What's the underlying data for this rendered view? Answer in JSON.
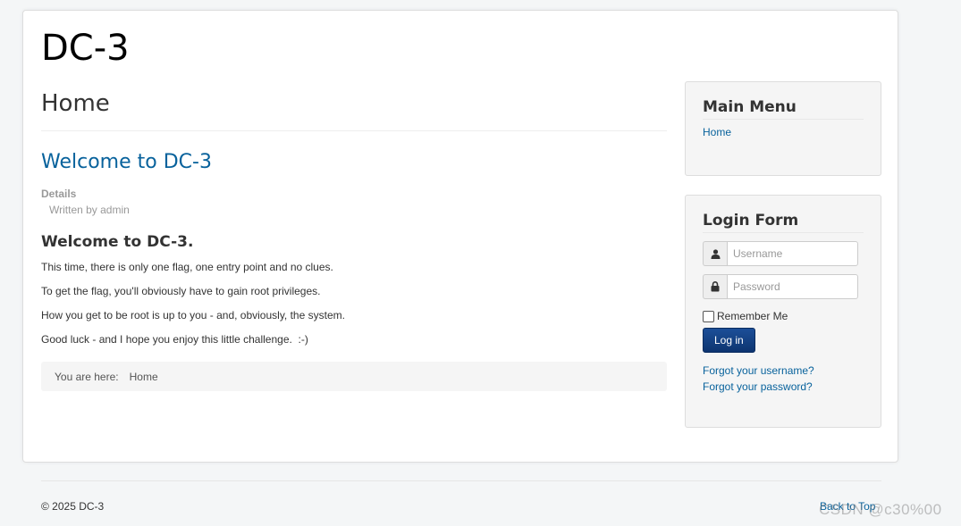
{
  "site": {
    "title": "DC-3"
  },
  "main": {
    "page_heading": "Home",
    "article": {
      "title": "Welcome to DC-3",
      "details_label": "Details",
      "author_line": "Written by admin",
      "heading": "Welcome to DC-3.",
      "paragraphs": [
        "This time, there is only one flag, one entry point and no clues.",
        "To get the flag, you'll obviously have to gain root privileges.",
        "How you get to be root is up to you - and, obviously, the system.",
        "Good luck - and I hope you enjoy this little challenge.  :-)"
      ]
    },
    "breadcrumb": {
      "label": "You are here:",
      "current": "Home"
    }
  },
  "sidebar": {
    "main_menu": {
      "title": "Main Menu",
      "items": [
        {
          "label": "Home"
        }
      ]
    },
    "login_form": {
      "title": "Login Form",
      "username_placeholder": "Username",
      "password_placeholder": "Password",
      "remember_label": "Remember Me",
      "login_button": "Log in",
      "forgot_username": "Forgot your username?",
      "forgot_password": "Forgot your password?",
      "icons": {
        "username": "user-icon",
        "password": "lock-icon"
      }
    }
  },
  "footer": {
    "copyright": "© 2025 DC-3",
    "back_to_top": "Back to Top"
  },
  "watermark": "CSDN @c30%00",
  "colors": {
    "link": "#08629c",
    "button": "#1c4f98",
    "background": "#f4f6f7"
  }
}
